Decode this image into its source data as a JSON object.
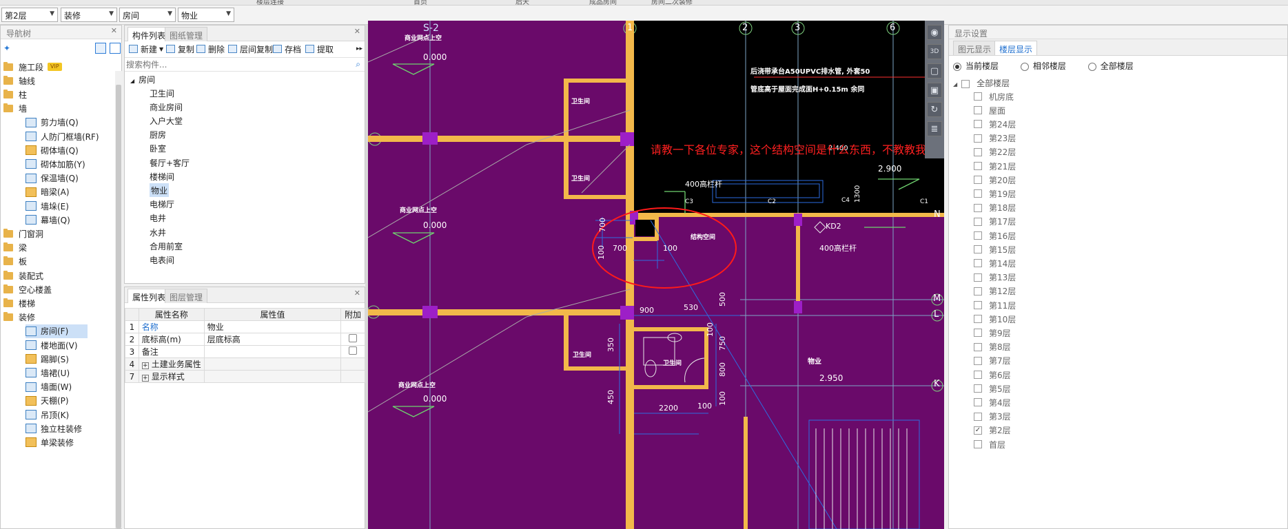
{
  "top_strip": [
    "楼层连接",
    "首页",
    "后天",
    "成品房间",
    "房间二次装修"
  ],
  "selectors": {
    "floor": "第2层",
    "category": "装修",
    "type": "房间",
    "component": "物业"
  },
  "nav": {
    "title": "导航树",
    "items": [
      {
        "label": "施工段",
        "type": "folder",
        "vip": "VIP"
      },
      {
        "label": "轴线",
        "type": "folder"
      },
      {
        "label": "柱",
        "type": "folder"
      },
      {
        "label": "墙",
        "type": "folder"
      },
      {
        "label": "剪力墙(Q)",
        "type": "child",
        "icon": "shear-wall-icon"
      },
      {
        "label": "人防门框墙(RF)",
        "type": "child",
        "icon": "civil-defense-door-wall-icon"
      },
      {
        "label": "砌体墙(Q)",
        "type": "child",
        "icon": "masonry-wall-icon"
      },
      {
        "label": "砌体加筋(Y)",
        "type": "child",
        "icon": "masonry-rebar-icon"
      },
      {
        "label": "保温墙(Q)",
        "type": "child",
        "icon": "insulation-wall-icon"
      },
      {
        "label": "暗梁(A)",
        "type": "child",
        "icon": "hidden-beam-icon"
      },
      {
        "label": "墙垛(E)",
        "type": "child",
        "icon": "wall-buttress-icon"
      },
      {
        "label": "幕墙(Q)",
        "type": "child",
        "icon": "curtain-wall-icon"
      },
      {
        "label": "门窗洞",
        "type": "folder"
      },
      {
        "label": "梁",
        "type": "folder"
      },
      {
        "label": "板",
        "type": "folder"
      },
      {
        "label": "装配式",
        "type": "folder"
      },
      {
        "label": "空心楼盖",
        "type": "folder"
      },
      {
        "label": "楼梯",
        "type": "folder"
      },
      {
        "label": "装修",
        "type": "folder"
      },
      {
        "label": "房间(F)",
        "type": "child",
        "icon": "room-icon",
        "selected": true
      },
      {
        "label": "楼地面(V)",
        "type": "child",
        "icon": "floor-icon"
      },
      {
        "label": "踢脚(S)",
        "type": "child",
        "icon": "skirting-icon"
      },
      {
        "label": "墙裙(U)",
        "type": "child",
        "icon": "wainscot-icon"
      },
      {
        "label": "墙面(W)",
        "type": "child",
        "icon": "wall-surface-icon"
      },
      {
        "label": "天棚(P)",
        "type": "child",
        "icon": "ceiling-icon"
      },
      {
        "label": "吊顶(K)",
        "type": "child",
        "icon": "suspended-ceiling-icon"
      },
      {
        "label": "独立柱装修",
        "type": "child",
        "icon": "column-finish-icon"
      },
      {
        "label": "单梁装修",
        "type": "child",
        "icon": "beam-finish-icon"
      }
    ]
  },
  "components": {
    "tabs": [
      "构件列表",
      "图纸管理"
    ],
    "toolbar": {
      "new": "新建",
      "copy": "复制",
      "delete": "删除",
      "floor_copy": "层间复制",
      "save": "存档",
      "extract": "提取"
    },
    "search_placeholder": "搜索构件...",
    "root": "房间",
    "items": [
      "卫生间",
      "商业房间",
      "入户大堂",
      "厨房",
      "卧室",
      "餐厅+客厅",
      "楼梯间",
      "物业",
      "电梯厅",
      "电井",
      "水井",
      "合用前室",
      "电表间"
    ],
    "selected": "物业"
  },
  "properties": {
    "tabs": [
      "属性列表",
      "图层管理"
    ],
    "headers": [
      "属性名称",
      "属性值",
      "附加"
    ],
    "rows": [
      {
        "num": "1",
        "name": "名称",
        "value": "物业",
        "check": false
      },
      {
        "num": "2",
        "name": "底标高(m)",
        "value": "层底标高",
        "check": true
      },
      {
        "num": "3",
        "name": "备注",
        "value": "",
        "check": true
      },
      {
        "num": "4",
        "name": "土建业务属性",
        "value": "",
        "expand": "+"
      },
      {
        "num": "7",
        "name": "显示样式",
        "value": "",
        "expand": "+"
      }
    ]
  },
  "drawing": {
    "annotation": "请教一下各位专家，这个结构空间是什么东西，不教教我的吗。",
    "axis_labels": [
      "S-2",
      "1",
      "2",
      "3",
      "6",
      "N",
      "M",
      "L",
      "K"
    ],
    "text": {
      "note1": "后浇带承台A50UPVC排水管, 外套50",
      "note2": "管底高于屋面完成面H+0.15m 余同",
      "elev1": "0.000",
      "elev2": "0.000",
      "elev3": "0.000",
      "merchant": "商业网点上空",
      "wc1": "卫生间",
      "wc2": "卫生间",
      "wc3": "卫生间",
      "wc4": "卫生间",
      "railing1": "400高栏杆",
      "railing2": "400高栏杆",
      "structural_space": "结构空间",
      "property": "物业",
      "kd2": "KD2",
      "d700a": "700",
      "d700b": "700",
      "d100a": "100",
      "d100b": "100",
      "d900": "900",
      "d530": "530",
      "d500": "500",
      "d350": "350",
      "d450": "450",
      "d750": "750",
      "d800": "800",
      "d100c": "100",
      "d100d": "100",
      "d2200": "2200",
      "d100e": "100",
      "d2950": "2.950",
      "d2900": "2.900",
      "d2400": "2.400",
      "d1300": "1300",
      "c1": "C1",
      "c2": "C2",
      "c3": "C3",
      "c4": "C4"
    }
  },
  "view_tools": [
    "navigate-cube-icon",
    "3d-view-icon",
    "box-view-icon",
    "box-solid-icon",
    "rotate-icon",
    "layer-stack-icon"
  ],
  "display": {
    "title": "显示设置",
    "tabs": [
      "图元显示",
      "楼层显示"
    ],
    "radios": [
      "当前楼层",
      "相邻楼层",
      "全部楼层"
    ],
    "root": "全部楼层",
    "floors": [
      "机房底",
      "屋面",
      "第24层",
      "第23层",
      "第22层",
      "第21层",
      "第20层",
      "第19层",
      "第18层",
      "第17层",
      "第16层",
      "第15层",
      "第14层",
      "第13层",
      "第12层",
      "第11层",
      "第10层",
      "第9层",
      "第8层",
      "第7层",
      "第6层",
      "第5层",
      "第4层",
      "第3层",
      "第2层",
      "首层"
    ],
    "checked": "第2层"
  },
  "colors": {
    "canvas": "#6a0a6a",
    "wall": "#f2b84a",
    "annotation": "#ff2020",
    "accent": "#1f6fcf"
  }
}
